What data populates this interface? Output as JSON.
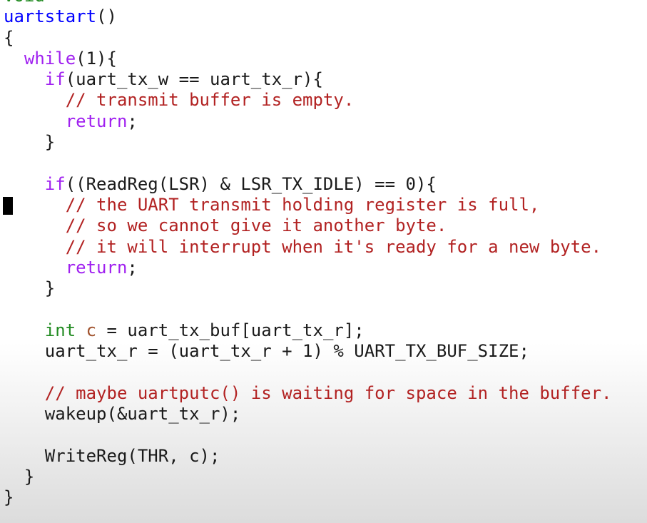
{
  "code": {
    "lines": [
      [
        {
          "t": "void",
          "c": "ty"
        }
      ],
      [
        {
          "t": "uartstart",
          "c": "fn"
        },
        {
          "t": "()",
          "c": "pl"
        }
      ],
      [
        {
          "t": "{",
          "c": "pl"
        }
      ],
      [
        {
          "t": "  ",
          "c": "pl"
        },
        {
          "t": "while",
          "c": "kw"
        },
        {
          "t": "(1){",
          "c": "pl"
        }
      ],
      [
        {
          "t": "    ",
          "c": "pl"
        },
        {
          "t": "if",
          "c": "kw"
        },
        {
          "t": "(uart_tx_w == uart_tx_r){",
          "c": "pl"
        }
      ],
      [
        {
          "t": "      ",
          "c": "pl"
        },
        {
          "t": "// transmit buffer is empty.",
          "c": "cm"
        }
      ],
      [
        {
          "t": "      ",
          "c": "pl"
        },
        {
          "t": "return",
          "c": "kw"
        },
        {
          "t": ";",
          "c": "pl"
        }
      ],
      [
        {
          "t": "    }",
          "c": "pl"
        }
      ],
      [
        {
          "t": "",
          "c": "pl"
        }
      ],
      [
        {
          "t": "    ",
          "c": "pl"
        },
        {
          "t": "if",
          "c": "kw"
        },
        {
          "t": "((ReadReg(LSR) & LSR_TX_IDLE) == 0){",
          "c": "pl"
        }
      ],
      [
        {
          "t": "      ",
          "c": "pl"
        },
        {
          "t": "// the UART transmit holding register is full,",
          "c": "cm"
        }
      ],
      [
        {
          "t": "      ",
          "c": "pl"
        },
        {
          "t": "// so we cannot give it another byte.",
          "c": "cm"
        }
      ],
      [
        {
          "t": "      ",
          "c": "pl"
        },
        {
          "t": "// it will interrupt when it's ready for a new byte.",
          "c": "cm"
        }
      ],
      [
        {
          "t": "      ",
          "c": "pl"
        },
        {
          "t": "return",
          "c": "kw"
        },
        {
          "t": ";",
          "c": "pl"
        }
      ],
      [
        {
          "t": "    }",
          "c": "pl"
        }
      ],
      [
        {
          "t": "",
          "c": "pl"
        }
      ],
      [
        {
          "t": "    ",
          "c": "pl"
        },
        {
          "t": "int",
          "c": "ty"
        },
        {
          "t": " ",
          "c": "pl"
        },
        {
          "t": "c",
          "c": "var"
        },
        {
          "t": " = uart_tx_buf[uart_tx_r];",
          "c": "pl"
        }
      ],
      [
        {
          "t": "    uart_tx_r = (uart_tx_r + 1) % UART_TX_BUF_SIZE;",
          "c": "pl"
        }
      ],
      [
        {
          "t": "",
          "c": "pl"
        }
      ],
      [
        {
          "t": "    ",
          "c": "pl"
        },
        {
          "t": "// maybe uartputc() is waiting for space in the buffer.",
          "c": "cm"
        }
      ],
      [
        {
          "t": "    wakeup(&uart_tx_r);",
          "c": "pl"
        }
      ],
      [
        {
          "t": "",
          "c": "pl"
        }
      ],
      [
        {
          "t": "    WriteReg(THR, c);",
          "c": "pl"
        }
      ],
      [
        {
          "t": "  }",
          "c": "pl"
        }
      ],
      [
        {
          "t": "}",
          "c": "pl"
        }
      ]
    ],
    "cursor_line": 11
  },
  "colors": {
    "keyword": "#a020f0",
    "type": "#228b22",
    "function_name": "#0000ff",
    "comment": "#b22222",
    "variable": "#a0522d",
    "plain": "#1a1a1a",
    "background": "#ffffff"
  }
}
